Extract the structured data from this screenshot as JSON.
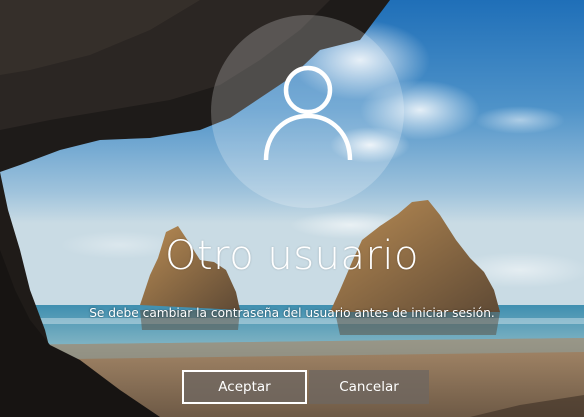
{
  "lock_screen": {
    "user_icon": "user-icon",
    "username": "Otro usuario",
    "message": "Se debe cambiar la contraseña del usuario antes de iniciar sesión.",
    "buttons": {
      "accept_label": "Aceptar",
      "cancel_label": "Cancelar"
    }
  }
}
